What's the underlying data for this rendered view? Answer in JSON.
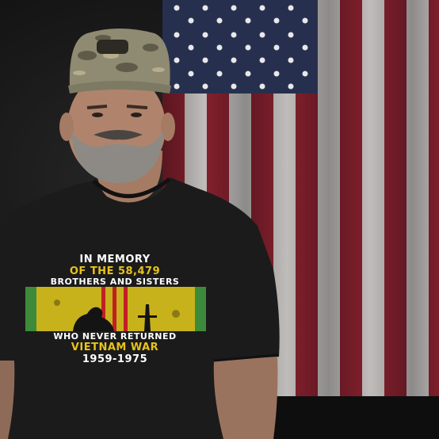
{
  "shirt": {
    "line1": "IN MEMORY",
    "line2": "OF THE 58,479",
    "line3": "BROTHERS AND SISTERS",
    "line4": "WHO NEVER RETURNED",
    "line5": "VIETNAM WAR",
    "line6": "1959-1975"
  },
  "colors": {
    "background": "#141414",
    "flag_red": "#8a2230",
    "flag_white": "#c9c6c4",
    "canton_blue": "#26304e",
    "shirt": "#1b1b1b",
    "print_yellow": "#e8c21a",
    "ribbon_green": "#3d8a3a",
    "ribbon_red": "#c21f24"
  }
}
